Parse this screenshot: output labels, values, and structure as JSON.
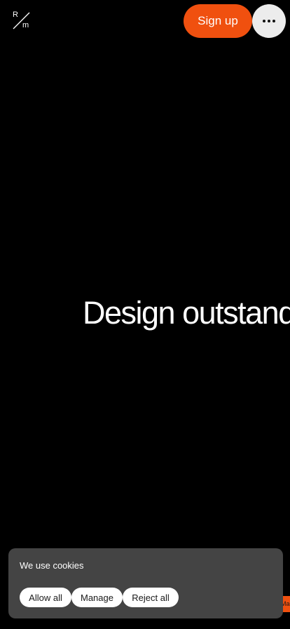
{
  "header": {
    "logo": {
      "top_letter": "R",
      "bottom_letter": "m"
    },
    "signup_label": "Sign up",
    "menu_icon": "more-horizontal-icon"
  },
  "hero": {
    "headline": "Design outstanding"
  },
  "edge_tab": {
    "label": "Made"
  },
  "cookie_banner": {
    "message": "We use cookies",
    "allow_label": "Allow all",
    "manage_label": "Manage",
    "reject_label": "Reject all"
  },
  "colors": {
    "background": "#000000",
    "accent": "#f0500f",
    "menu_button": "#ececec",
    "banner": "#444444"
  }
}
